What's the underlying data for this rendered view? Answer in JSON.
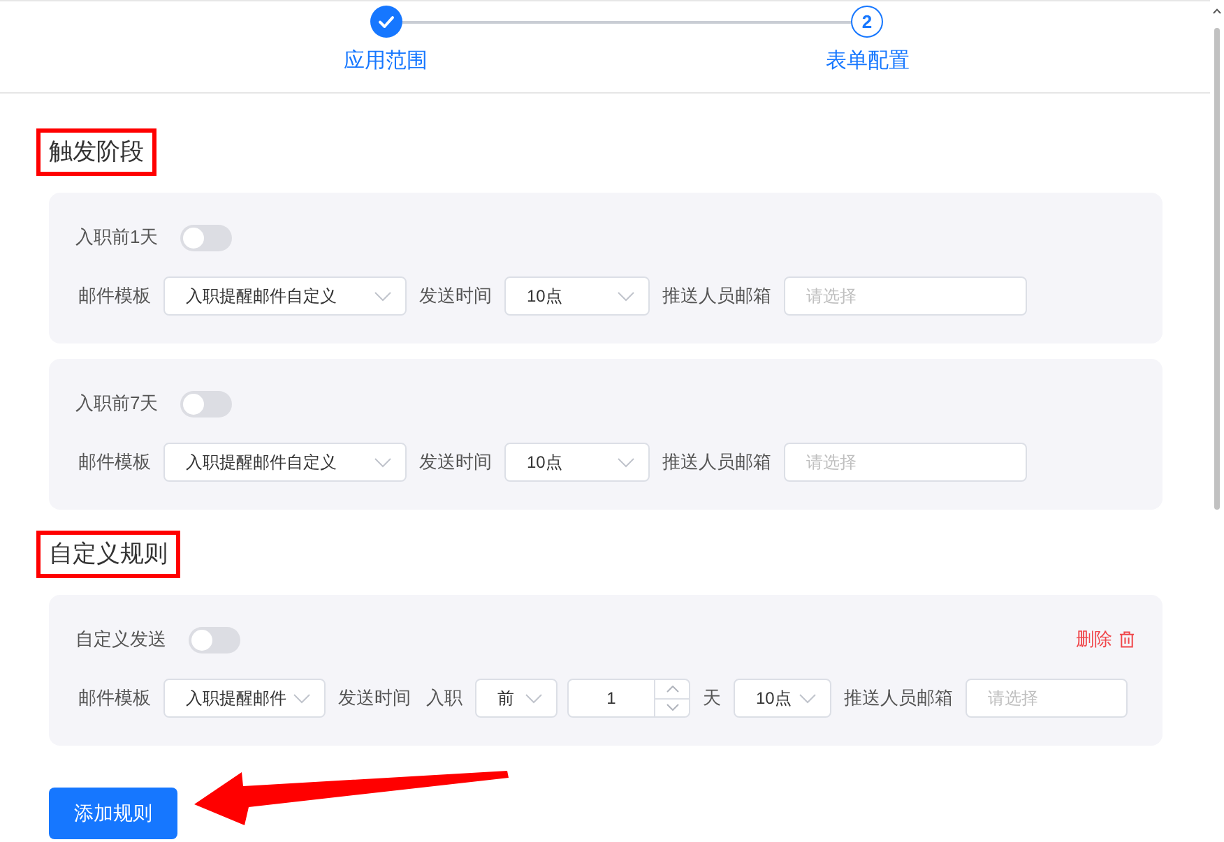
{
  "steps": [
    {
      "label": "应用范围",
      "completed": true
    },
    {
      "number": "2",
      "label": "表单配置",
      "completed": false
    }
  ],
  "sections": [
    {
      "title": "触发阶段",
      "annotated": true,
      "cards": [
        {
          "kind": "preset",
          "toggle_label": "入职前1天",
          "on": false,
          "fields": [
            {
              "kind": "label",
              "text": "邮件模板"
            },
            {
              "kind": "select",
              "value": "入职提醒邮件自定义"
            },
            {
              "kind": "label",
              "text": "发送时间"
            },
            {
              "kind": "select",
              "value": "10点"
            },
            {
              "kind": "label",
              "text": "推送人员邮箱"
            },
            {
              "kind": "input",
              "placeholder": "请选择"
            }
          ]
        },
        {
          "kind": "preset",
          "toggle_label": "入职前7天",
          "on": false,
          "fields": [
            {
              "kind": "label",
              "text": "邮件模板"
            },
            {
              "kind": "select",
              "value": "入职提醒邮件自定义"
            },
            {
              "kind": "label",
              "text": "发送时间"
            },
            {
              "kind": "select",
              "value": "10点"
            },
            {
              "kind": "label",
              "text": "推送人员邮箱"
            },
            {
              "kind": "input",
              "placeholder": "请选择"
            }
          ]
        }
      ]
    },
    {
      "title": "自定义规则",
      "annotated": true,
      "cards": [
        {
          "kind": "custom",
          "toggle_label": "自定义发送",
          "on": false,
          "delete_label": "删除",
          "fields": [
            {
              "kind": "label",
              "text": "邮件模板"
            },
            {
              "kind": "select",
              "value": "入职提醒邮件"
            },
            {
              "kind": "label",
              "text": "发送时间"
            },
            {
              "kind": "label",
              "text": "入职"
            },
            {
              "kind": "select",
              "value": "前"
            },
            {
              "kind": "number",
              "value": "1"
            },
            {
              "kind": "label",
              "text": "天"
            },
            {
              "kind": "select",
              "value": "10点"
            },
            {
              "kind": "label",
              "text": "推送人员邮箱"
            },
            {
              "kind": "input",
              "placeholder": "请选择"
            }
          ]
        }
      ]
    }
  ],
  "add_button": "添加规则"
}
